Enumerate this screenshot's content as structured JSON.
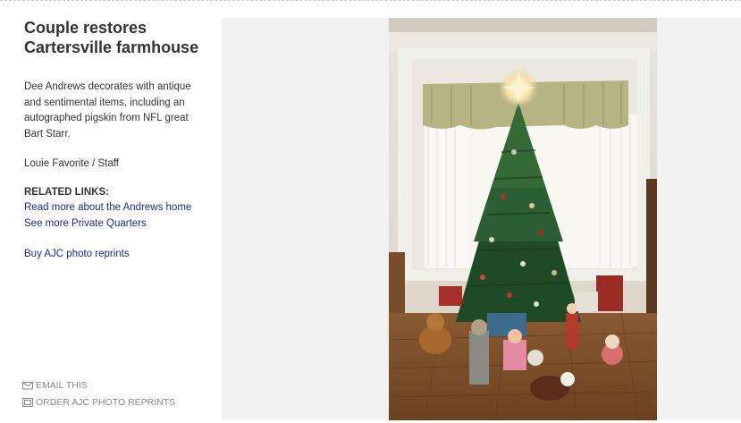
{
  "article": {
    "title": "Couple restores Cartersville farmhouse",
    "caption": "Dee Andrews decorates with antique and sentimental items, including an autographed pigskin from NFL great Bart Starr.",
    "credit": "Louie Favorite / Staff"
  },
  "related": {
    "heading": "RELATED LINKS:",
    "links": [
      "Read more about the Andrews home",
      "See more Private Quarters"
    ]
  },
  "reprints_link": "Buy AJC photo reprints",
  "actions": {
    "email": {
      "label": "EMAIL THIS",
      "icon": "envelope-icon"
    },
    "order": {
      "label": "ORDER AJC PHOTO REPRINTS",
      "icon": "photo-reprint-icon"
    }
  },
  "photo": {
    "subject": "christmas-tree-photo"
  },
  "colors": {
    "link": "#1a2c8c",
    "text": "#333333",
    "muted": "#8a8a8a",
    "panel": "#f1f1f1"
  }
}
